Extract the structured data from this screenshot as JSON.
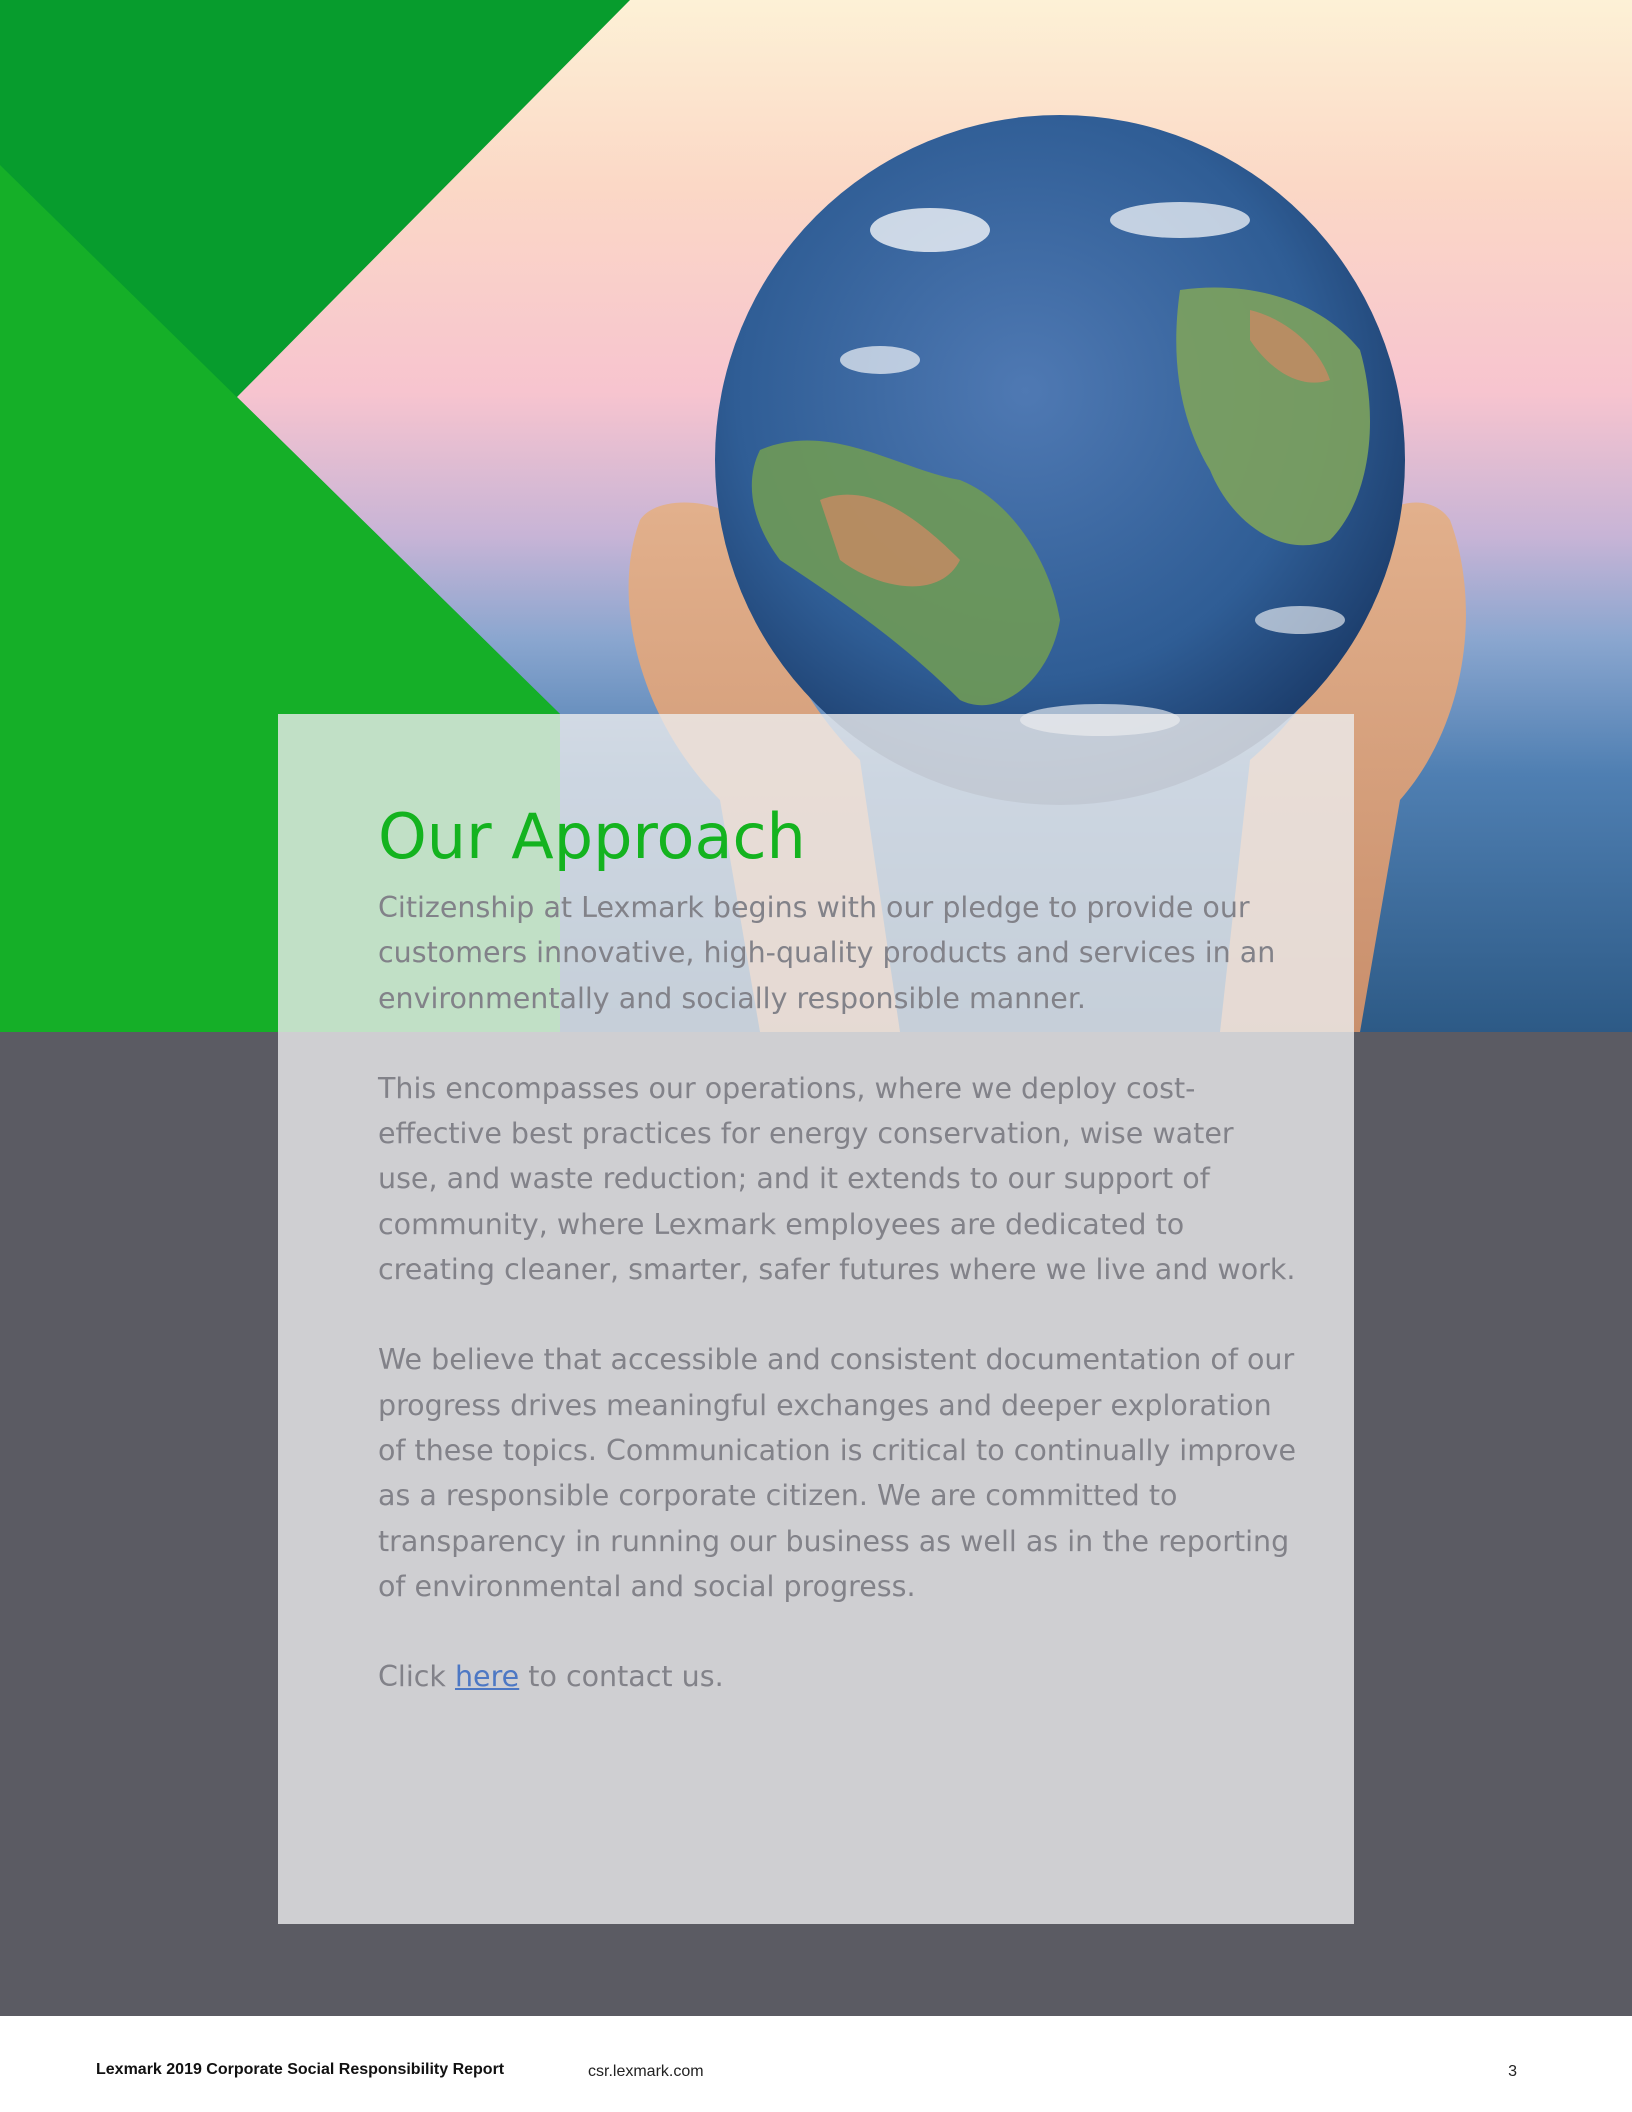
{
  "card": {
    "title": "Our Approach",
    "paragraphs": [
      "Citizenship at Lexmark begins with our pledge to provide our customers innovative, high-quality products and services in an environmentally and socially responsible manner.",
      "This encompasses our operations, where we deploy cost-effective best practices for energy conservation, wise water use, and waste reduction; and it extends to our support of community, where Lexmark employees are dedicated to creating cleaner, smarter, safer futures where we live and work.",
      "We believe that accessible and consistent documentation of our progress drives meaningful exchanges and deeper exploration of these topics. Communication is critical to continually improve as a responsible corporate citizen. We are committed to transparency in running our business as well as in the reporting of environmental and social progress."
    ],
    "contact": {
      "prefix": "Click ",
      "link_text": "here",
      "suffix": " to contact us."
    }
  },
  "footer": {
    "report_title": "Lexmark 2019 Corporate Social Responsibility Report",
    "url": "csr.lexmark.com",
    "page_number": "3"
  },
  "colors": {
    "brand_green": "#14b31f",
    "dark_band": "#5b5b63",
    "body_text": "#828289",
    "link": "#4d78c4"
  }
}
